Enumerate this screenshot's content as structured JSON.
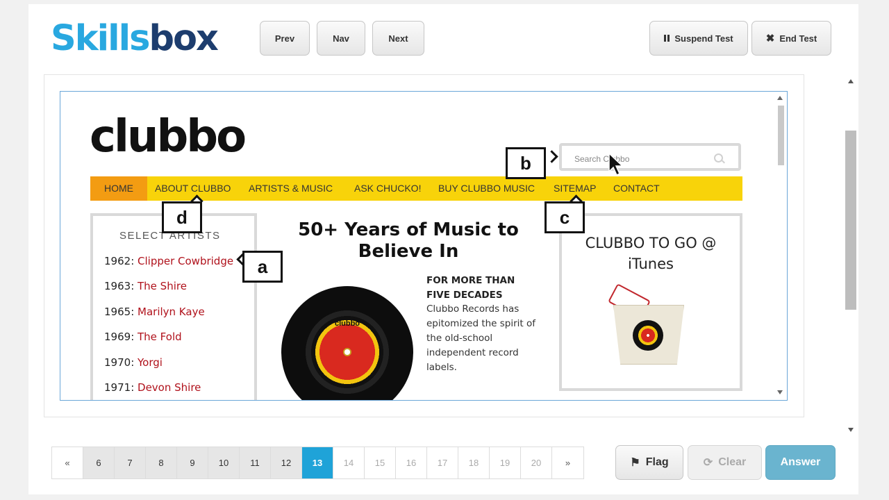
{
  "brand": {
    "logo_part1": "Skills",
    "logo_part2": "box",
    "color_primary": "#29a8e0",
    "color_secondary": "#1d3d6e"
  },
  "toolbar": {
    "prev_label": "Prev",
    "nav_label": "Nav",
    "next_label": "Next",
    "suspend_label": "Suspend Test",
    "end_label": "End Test"
  },
  "site": {
    "logo": "clubbo",
    "search_placeholder": "Search Clubbo",
    "nav": [
      "HOME",
      "ABOUT CLUBBO",
      "ARTISTS & MUSIC",
      "ASK CHUCKO!",
      "BUY CLUBBO MUSIC",
      "SITEMAP",
      "CONTACT"
    ],
    "sidebar_title": "SELECT ARTISTS",
    "artists": [
      {
        "year": "1962",
        "name": "Clipper Cowbridge"
      },
      {
        "year": "1963",
        "name": "The Shire"
      },
      {
        "year": "1965",
        "name": "Marilyn Kaye"
      },
      {
        "year": "1969",
        "name": "The Fold"
      },
      {
        "year": "1970",
        "name": "Yorgi"
      },
      {
        "year": "1971",
        "name": "Devon Shire"
      }
    ],
    "headline": "50+ Years of Music to Believe In",
    "intro_heading": "FOR MORE THAN FIVE DECADES",
    "intro_text": "Clubbo Records has epitomized the spirit of the old-school independent record labels.",
    "record_label": "clubbo",
    "itunes_title": "CLUBBO TO GO @ iTunes",
    "accent_yellow": "#f8d30a",
    "accent_orange": "#f39c12",
    "link_red": "#b0111b"
  },
  "callouts": {
    "a": "a",
    "b": "b",
    "c": "c",
    "d": "d"
  },
  "pager": {
    "first": "«",
    "last": "»",
    "pages": [
      "6",
      "7",
      "8",
      "9",
      "10",
      "11",
      "12",
      "13",
      "14",
      "15",
      "16",
      "17",
      "18",
      "19",
      "20"
    ],
    "current": "13"
  },
  "footer": {
    "flag_label": "Flag",
    "clear_label": "Clear",
    "answer_label": "Answer"
  }
}
